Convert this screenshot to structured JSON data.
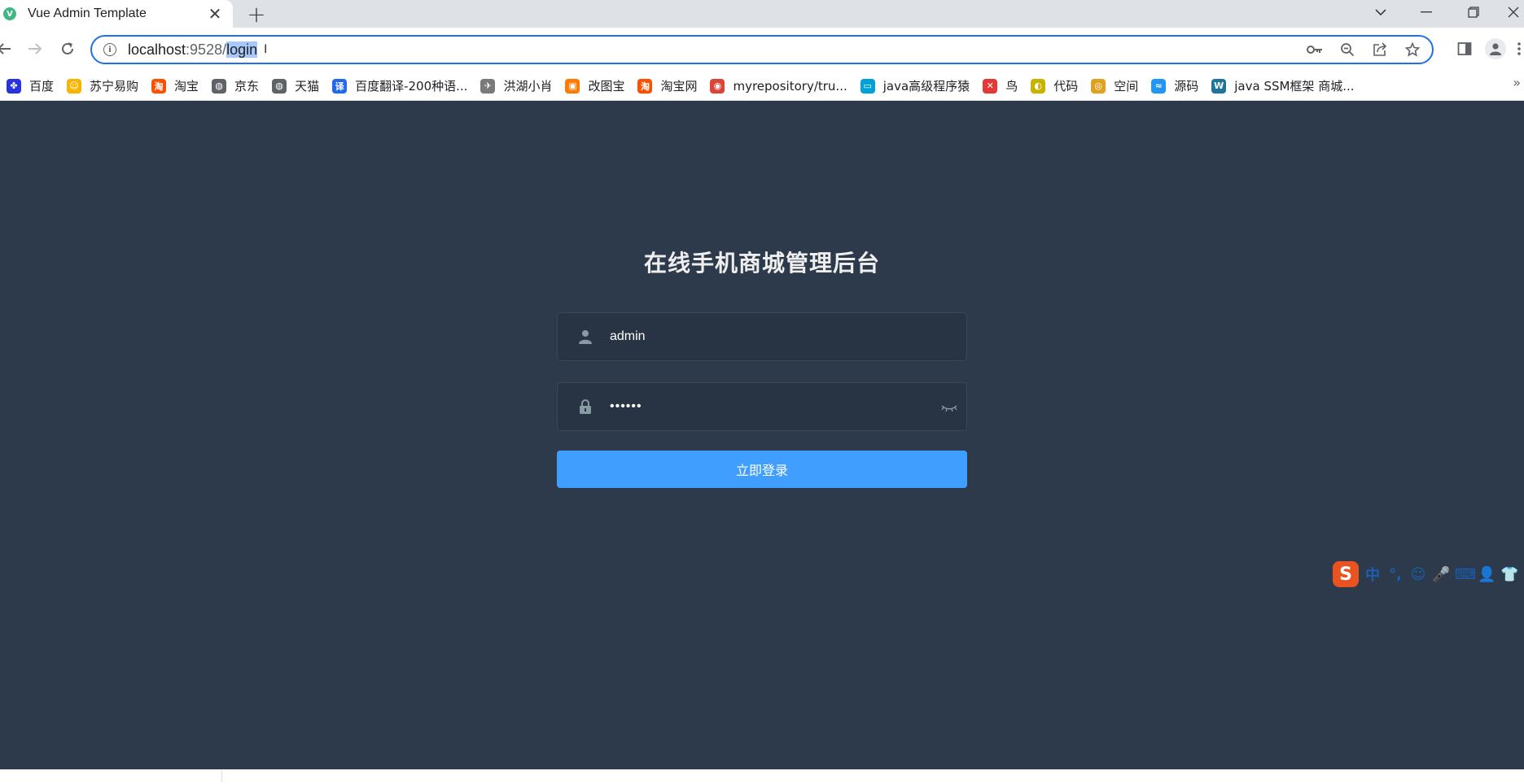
{
  "browser": {
    "tab_title": "Vue Admin Template",
    "tab_favicon": "V",
    "url_host": "localhost",
    "url_port": ":9528/",
    "url_path_selected": "login"
  },
  "bookmarks": [
    {
      "label": "百度",
      "icon": "paw-icon",
      "color": "#2932e1",
      "glyph": "✤"
    },
    {
      "label": "苏宁易购",
      "icon": "lion-icon",
      "color": "#f7b500",
      "glyph": "☺"
    },
    {
      "label": "淘宝",
      "icon": "taobao-icon",
      "color": "#ff5000",
      "glyph": "淘"
    },
    {
      "label": "京东",
      "icon": "globe-icon",
      "color": "#5f6368",
      "glyph": "◍"
    },
    {
      "label": "天猫",
      "icon": "globe-icon",
      "color": "#5f6368",
      "glyph": "◍"
    },
    {
      "label": "百度翻译-200种语...",
      "icon": "translate-icon",
      "color": "#2468f2",
      "glyph": "译"
    },
    {
      "label": "洪湖小肖",
      "icon": "bird-icon",
      "color": "#7a7a7a",
      "glyph": "✈"
    },
    {
      "label": "改图宝",
      "icon": "image-icon",
      "color": "#ff7a00",
      "glyph": "▣"
    },
    {
      "label": "淘宝网",
      "icon": "taobao-icon",
      "color": "#ff5000",
      "glyph": "淘"
    },
    {
      "label": "myrepository/tru...",
      "icon": "chrome-icon",
      "color": "#db4437",
      "glyph": "◉"
    },
    {
      "label": "java高级程序猿",
      "icon": "bilibili-icon",
      "color": "#00a1d6",
      "glyph": "▭"
    },
    {
      "label": "鸟",
      "icon": "bird-red-icon",
      "color": "#e53935",
      "glyph": "✕"
    },
    {
      "label": "代码",
      "icon": "code-icon",
      "color": "#c8b400",
      "glyph": "◐"
    },
    {
      "label": "空间",
      "icon": "qzone-icon",
      "color": "#e0a020",
      "glyph": "◎"
    },
    {
      "label": "源码",
      "icon": "fish-icon",
      "color": "#2196f3",
      "glyph": "≈"
    },
    {
      "label": "java SSM框架 商城...",
      "icon": "wordpress-icon",
      "color": "#21759b",
      "glyph": "W"
    }
  ],
  "login": {
    "title": "在线手机商城管理后台",
    "username_value": "admin",
    "password_value": "••••••",
    "submit_label": "立即登录"
  },
  "ime": {
    "logo": "S",
    "items": [
      "中",
      "°,",
      "☺",
      "🎤",
      "⌨",
      "👤",
      "👕"
    ]
  },
  "colors": {
    "page_bg": "#2d3a4b",
    "input_bg": "#283443",
    "button_primary": "#409eff",
    "omnibox_border": "#1a73e8"
  }
}
